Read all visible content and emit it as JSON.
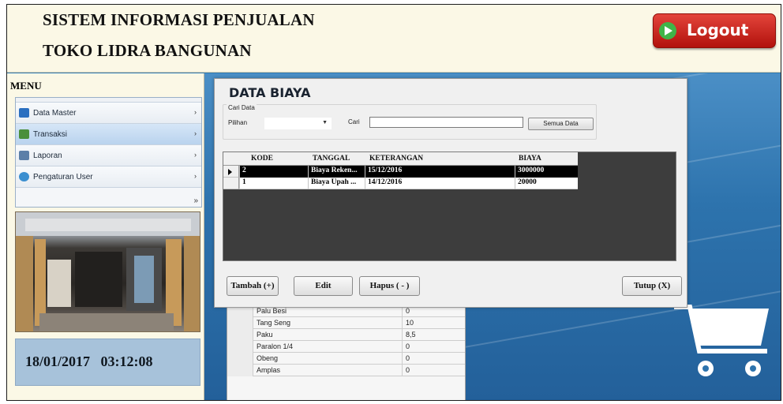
{
  "header": {
    "title_line1": "SISTEM INFORMASI PENJUALAN",
    "title_line2": "TOKO LIDRA BANGUNAN",
    "logout_label": "Logout"
  },
  "sidebar": {
    "menu_title": "MENU",
    "items": [
      {
        "label": "Data Master",
        "icon": "users-icon"
      },
      {
        "label": "Transaksi",
        "icon": "transaction-icon"
      },
      {
        "label": "Laporan",
        "icon": "report-icon"
      },
      {
        "label": "Pengaturan User",
        "icon": "settings-icon"
      }
    ],
    "more_glyph": "»",
    "submenu_arrow": "›",
    "datetime": "18/01/2017   03:12:08"
  },
  "dialog": {
    "title": "DATA BIAYA",
    "search": {
      "group_label": "Cari Data",
      "pilihan_label": "Pilihan",
      "pilihan_value": "",
      "cari_label": "Cari",
      "cari_value": "",
      "semua_button": "Semua Data"
    },
    "grid": {
      "columns": [
        "KODE",
        "TANGGAL",
        "KETERANGAN",
        "BIAYA"
      ],
      "rows": [
        {
          "kode": "2",
          "tanggal": "Biaya Reken...",
          "keterangan": "15/12/2016",
          "biaya": "3000000",
          "selected": true
        },
        {
          "kode": "1",
          "tanggal": "Biaya Upah ...",
          "keterangan": "14/12/2016",
          "biaya": "20000",
          "selected": false
        }
      ]
    },
    "buttons": {
      "tambah": "Tambah (+)",
      "edit": "Edit",
      "hapus": "Hapus ( - )",
      "tutup": "Tutup (X)"
    }
  },
  "background_grid": {
    "rows": [
      {
        "name": "Palu Besi",
        "value": "0"
      },
      {
        "name": "Tang Seng",
        "value": "10"
      },
      {
        "name": "Paku",
        "value": "8,5"
      },
      {
        "name": "Paralon 1/4",
        "value": "0"
      },
      {
        "name": "Obeng",
        "value": "0"
      },
      {
        "name": "Amplas",
        "value": "0"
      }
    ]
  },
  "colors": {
    "header_bg": "#fbf8e6",
    "logout_red": "#c8231b",
    "stage_blue": "#2f7cb6",
    "selected_row": "#000000"
  }
}
